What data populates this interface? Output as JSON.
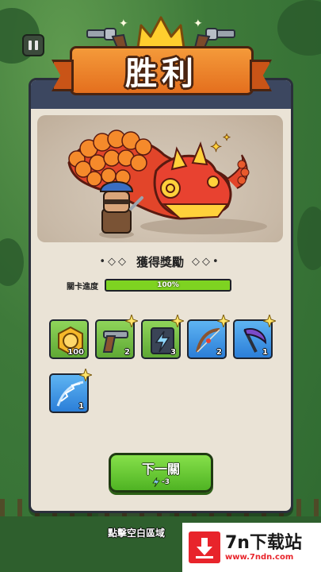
{
  "header": {
    "title": "胜利"
  },
  "reward": {
    "title": "獲得獎勵",
    "deco_left": "•◇◇",
    "deco_right": "◇◇•"
  },
  "progress": {
    "label": "關卡進度",
    "value": 1.0,
    "text": "100%"
  },
  "items": [
    {
      "name": "coin-item",
      "icon": "coin-icon",
      "count": "100",
      "rarity": "green"
    },
    {
      "name": "revolver-item",
      "icon": "revolver-icon",
      "count": "2",
      "rarity": "green"
    },
    {
      "name": "energy-card-item",
      "icon": "energy-card-icon",
      "count": "3",
      "rarity": "green"
    },
    {
      "name": "bow-item",
      "icon": "bow-icon",
      "count": "2",
      "rarity": "blue"
    },
    {
      "name": "scythe-item",
      "icon": "scythe-icon",
      "count": "1",
      "rarity": "blue"
    },
    {
      "name": "lightning-bow-item",
      "icon": "lightning-bow-icon",
      "count": "1",
      "rarity": "blue"
    }
  ],
  "next_button": {
    "label": "下一關",
    "cost": "-3",
    "cost_icon": "energy-icon"
  },
  "hint": {
    "text": "點擊空白區域"
  },
  "watermark": {
    "title": "7n下载站",
    "url": "www.7ndn.com"
  },
  "colors": {
    "panel": "#eae3d6",
    "banner": "#e46f1e",
    "green_slot": "#6fbd3f",
    "blue_slot": "#3b8fe2",
    "progress": "#7ed321"
  }
}
